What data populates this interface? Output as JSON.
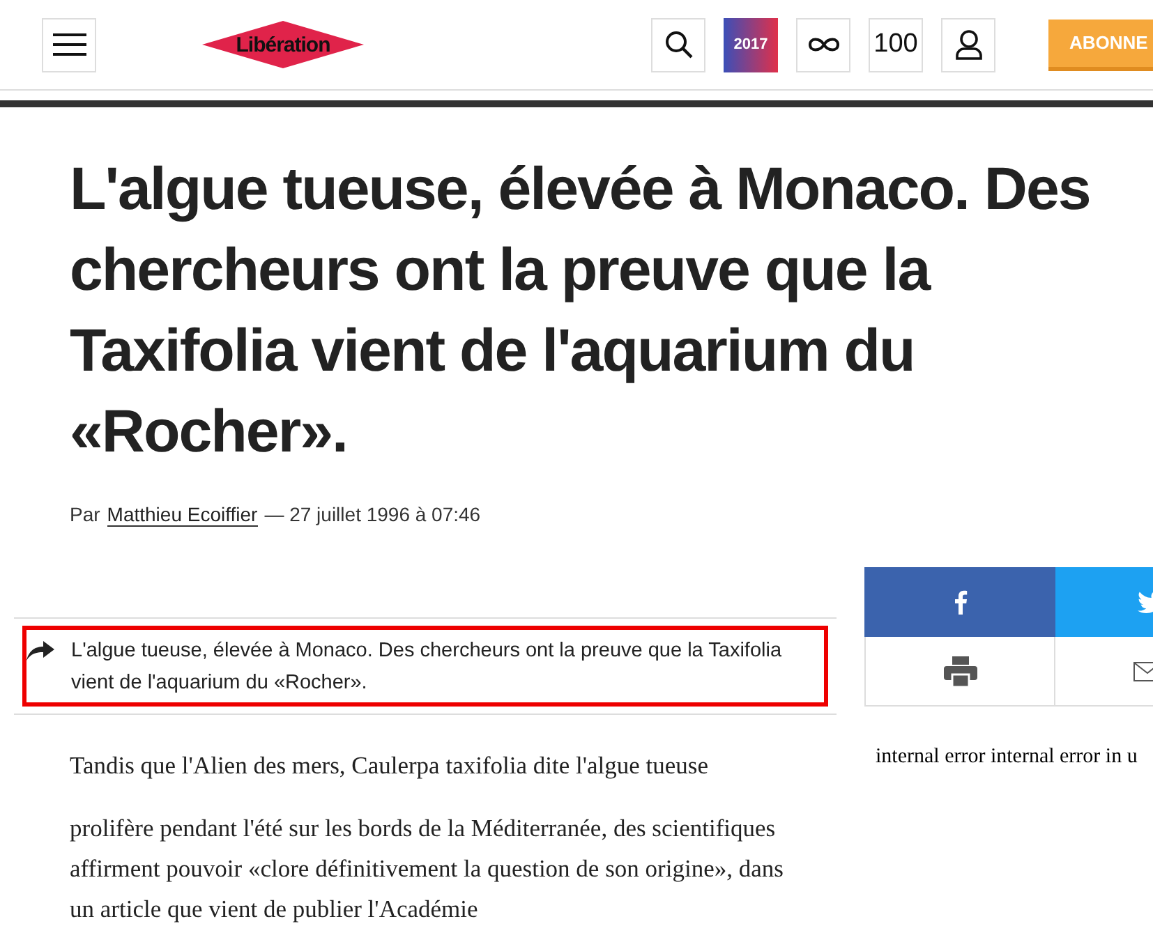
{
  "header": {
    "logo": "Libération",
    "badge_2017": "2017",
    "counter": "100",
    "subscribe": "ABONNE"
  },
  "article": {
    "headline": "L'algue tueuse, élevée à Monaco. Des chercheurs ont la preuve que la Taxifolia vient de l'aquarium du «Rocher».",
    "byline_prefix": "Par",
    "author": "Matthieu Ecoiffier",
    "date": "— 27 juillet 1996 à 07:46",
    "summary": "L'algue tueuse, élevée à Monaco. Des chercheurs ont la preuve que la Taxifolia vient de l'aquarium du «Rocher».",
    "paragraphs": [
      "Tandis que l'Alien des mers, Caulerpa taxifolia dite l'algue tueuse",
      "prolifère pendant l'été sur les bords de la Méditerranée, des scientifiques affirment pouvoir «clore définitivement la question de son origine», dans un article que vient de publier l'Académie"
    ]
  },
  "sidebar": {
    "error": "internal error internal error in u"
  }
}
